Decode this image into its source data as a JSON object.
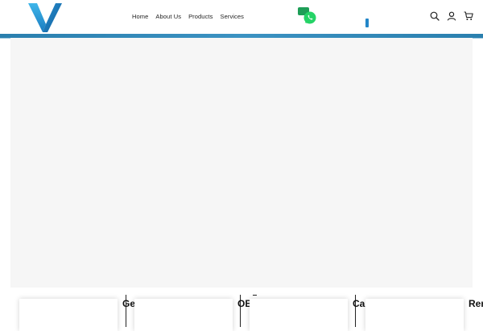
{
  "brand": {
    "accent": "#2386c8",
    "bar": "#2a7fae",
    "whatsapp": "#25d366"
  },
  "nav": {
    "items": [
      {
        "label": "Home"
      },
      {
        "label": "About Us"
      },
      {
        "label": "Products"
      },
      {
        "label": "Services"
      }
    ]
  },
  "icons": {
    "logo": "v-logo",
    "contact": "whatsapp-icon",
    "search": "search-icon",
    "account": "user-icon",
    "cart": "cart-icon"
  },
  "cards": [
    {
      "label": "Ge"
    },
    {
      "label": "OB"
    },
    {
      "label": "Ca"
    },
    {
      "label": "Rer"
    }
  ]
}
